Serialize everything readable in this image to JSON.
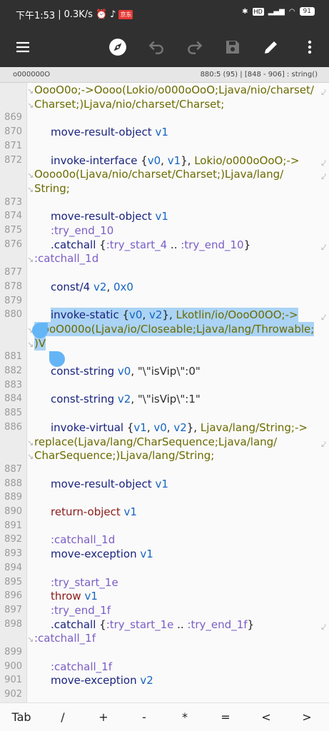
{
  "status": {
    "time": "下午1:53",
    "speed": "0.3K/s",
    "battery": "91",
    "badge": "HD",
    "appbadge": "京东"
  },
  "toolbar": {
    "menu_icon": "menu-icon",
    "compass_icon": "compass-icon",
    "undo_icon": "undo-icon",
    "redo_icon": "redo-icon",
    "save_icon": "save-icon",
    "edit_icon": "pencil-icon",
    "more_icon": "more-vert-icon"
  },
  "info": {
    "filename": "o000000O",
    "position": "880:5 (95)  |  [848 - 906] : string()"
  },
  "lines": [
    {
      "n": "",
      "frag": [
        [
          "typ",
          "OooO0o;->Oooo(Lokio/o000oOoO;Ljava/nio/charset/"
        ]
      ],
      "wrap": true,
      "cont": true
    },
    {
      "n": "",
      "frag": [
        [
          "typ",
          "Charset;)Ljava/nio/charset/Charset;"
        ]
      ],
      "cont": true
    },
    {
      "n": "869",
      "frag": []
    },
    {
      "n": "870",
      "frag": [
        [
          "kw",
          "move-result-object"
        ],
        [
          "reg",
          " v1"
        ]
      ],
      "indent": true
    },
    {
      "n": "871",
      "frag": []
    },
    {
      "n": "872",
      "frag": [
        [
          "kw",
          "invoke-interface"
        ],
        [
          "pun",
          " {"
        ],
        [
          "reg",
          "v0"
        ],
        [
          "pun",
          ", "
        ],
        [
          "reg",
          "v1"
        ],
        [
          "pun",
          "}, "
        ],
        [
          "typ",
          "Lokio/o000oOoO;->"
        ]
      ],
      "indent": true,
      "wrap": true
    },
    {
      "n": "",
      "frag": [
        [
          "typ",
          "Oooo0o(Ljava/nio/charset/Charset;)Ljava/lang/"
        ]
      ],
      "wrap": true,
      "cont": true
    },
    {
      "n": "",
      "frag": [
        [
          "typ",
          "String;"
        ]
      ],
      "cont": true
    },
    {
      "n": "873",
      "frag": []
    },
    {
      "n": "874",
      "frag": [
        [
          "kw",
          "move-result-object"
        ],
        [
          "reg",
          " v1"
        ]
      ],
      "indent": true
    },
    {
      "n": "875",
      "frag": [
        [
          "lbl",
          ":try_end_10"
        ]
      ],
      "indent": true
    },
    {
      "n": "876",
      "frag": [
        [
          "kw",
          ".catchall"
        ],
        [
          "pun",
          " {"
        ],
        [
          "lbl",
          ":try_start_4"
        ],
        [
          "pun",
          " .. "
        ],
        [
          "lbl",
          ":try_end_10"
        ],
        [
          "pun",
          "}"
        ]
      ],
      "indent": true,
      "wrap": true
    },
    {
      "n": "",
      "frag": [
        [
          "lbl",
          ":catchall_1d"
        ]
      ],
      "cont": true
    },
    {
      "n": "877",
      "frag": []
    },
    {
      "n": "878",
      "frag": [
        [
          "kw",
          "const/4"
        ],
        [
          "reg",
          " v2"
        ],
        [
          "pun",
          ", "
        ],
        [
          "num",
          "0x0"
        ]
      ],
      "indent": true
    },
    {
      "n": "879",
      "frag": []
    },
    {
      "n": "880",
      "frag": [
        [
          "kw",
          "invoke-static"
        ],
        [
          "pun",
          " {"
        ],
        [
          "reg",
          "v0"
        ],
        [
          "pun",
          ", "
        ],
        [
          "reg",
          "v2"
        ],
        [
          "pun",
          "}, "
        ],
        [
          "typ",
          "Lkotlin/io/OooO0OO;->"
        ]
      ],
      "indent": true,
      "wrap": true,
      "sel": true
    },
    {
      "n": "",
      "frag": [
        [
          "typ",
          "OooO000o(Ljava/io/Closeable;Ljava/lang/Throwable;"
        ]
      ],
      "cont": true,
      "sel": true
    },
    {
      "n": "",
      "frag": [
        [
          "typ",
          ")V"
        ]
      ],
      "cont": true,
      "sel": true
    },
    {
      "n": "881",
      "frag": []
    },
    {
      "n": "882",
      "frag": [
        [
          "kw",
          "const-string"
        ],
        [
          "reg",
          " v0"
        ],
        [
          "pun",
          ", "
        ],
        [
          "str",
          "\"\\\"isVip\\\":0\""
        ]
      ],
      "indent": true
    },
    {
      "n": "883",
      "frag": []
    },
    {
      "n": "884",
      "frag": [
        [
          "kw",
          "const-string"
        ],
        [
          "reg",
          " v2"
        ],
        [
          "pun",
          ", "
        ],
        [
          "str",
          "\"\\\"isVip\\\":1\""
        ]
      ],
      "indent": true
    },
    {
      "n": "885",
      "frag": []
    },
    {
      "n": "886",
      "frag": [
        [
          "kw",
          "invoke-virtual"
        ],
        [
          "pun",
          " {"
        ],
        [
          "reg",
          "v1"
        ],
        [
          "pun",
          ", "
        ],
        [
          "reg",
          "v0"
        ],
        [
          "pun",
          ", "
        ],
        [
          "reg",
          "v2"
        ],
        [
          "pun",
          "}, "
        ],
        [
          "typ",
          "Ljava/lang/String;->"
        ]
      ],
      "indent": true
    },
    {
      "n": "",
      "frag": [
        [
          "typ",
          "replace(Ljava/lang/CharSequence;Ljava/lang/"
        ]
      ],
      "wrap": true,
      "cont": true
    },
    {
      "n": "",
      "frag": [
        [
          "typ",
          "CharSequence;)Ljava/lang/String;"
        ]
      ],
      "cont": true
    },
    {
      "n": "887",
      "frag": []
    },
    {
      "n": "888",
      "frag": [
        [
          "kw",
          "move-result-object"
        ],
        [
          "reg",
          " v1"
        ]
      ],
      "indent": true
    },
    {
      "n": "889",
      "frag": []
    },
    {
      "n": "890",
      "frag": [
        [
          "ret",
          "return-object"
        ],
        [
          "reg",
          " v1"
        ]
      ],
      "indent": true
    },
    {
      "n": "891",
      "frag": []
    },
    {
      "n": "892",
      "frag": [
        [
          "lbl",
          ":catchall_1d"
        ]
      ],
      "indent": true
    },
    {
      "n": "893",
      "frag": [
        [
          "kw",
          "move-exception"
        ],
        [
          "reg",
          " v1"
        ]
      ],
      "indent": true
    },
    {
      "n": "894",
      "frag": []
    },
    {
      "n": "895",
      "frag": [
        [
          "lbl",
          ":try_start_1e"
        ]
      ],
      "indent": true
    },
    {
      "n": "896",
      "frag": [
        [
          "ret",
          "throw"
        ],
        [
          "reg",
          " v1"
        ]
      ],
      "indent": true
    },
    {
      "n": "897",
      "frag": [
        [
          "lbl",
          ":try_end_1f"
        ]
      ],
      "indent": true
    },
    {
      "n": "898",
      "frag": [
        [
          "kw",
          ".catchall"
        ],
        [
          "pun",
          " {"
        ],
        [
          "lbl",
          ":try_start_1e"
        ],
        [
          "pun",
          " .. "
        ],
        [
          "lbl",
          ":try_end_1f"
        ],
        [
          "pun",
          "}"
        ]
      ],
      "indent": true,
      "wrap": true
    },
    {
      "n": "",
      "frag": [
        [
          "lbl",
          ":catchall_1f"
        ]
      ],
      "cont": true
    },
    {
      "n": "899",
      "frag": []
    },
    {
      "n": "900",
      "frag": [
        [
          "lbl",
          ":catchall_1f"
        ]
      ],
      "indent": true
    },
    {
      "n": "901",
      "frag": [
        [
          "kw",
          "move-exception"
        ],
        [
          "reg",
          " v2"
        ]
      ],
      "indent": true
    },
    {
      "n": "902",
      "frag": []
    }
  ],
  "keys": [
    "Tab",
    "/",
    "+",
    "-",
    "*",
    "=",
    "<",
    ">"
  ]
}
